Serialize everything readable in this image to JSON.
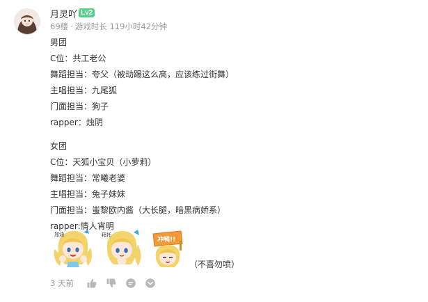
{
  "user": {
    "name": "月灵吖",
    "level": "Lv2"
  },
  "meta": {
    "floor": "69楼",
    "separator": "·",
    "play_time": "游戏时长 119小时42分钟"
  },
  "male_group": {
    "title": "男团",
    "lines": [
      "C位：共工老公",
      "舞蹈担当：夸父（被动踢这么高，应该练过街舞）",
      "主唱担当：九尾狐",
      "门面担当：狗子",
      "rapper：烛阴"
    ]
  },
  "female_group": {
    "title": "女团",
    "lines": [
      "C位：天狐小宝贝（小萝莉）",
      "舞蹈担当：常曦老婆",
      "主唱担当：兔子妹妹",
      "门面担当：蚩黎欧内酱（大长腿，暗黑病娇系）",
      "rapper:情人宵明"
    ]
  },
  "stickers": {
    "s1_text": "加油",
    "s2_text": "拜托",
    "s3_text": "冲鸭!!",
    "note": "（不喜勿喷）"
  },
  "footer": {
    "time": "3 天前"
  },
  "colors": {
    "text": "#333333",
    "meta": "#999999",
    "level_badge": "#56d08a",
    "icon": "#b8b8b8"
  },
  "icons": [
    "avatar",
    "thumb-up-icon",
    "thumb-down-icon",
    "comment-icon",
    "more-icon"
  ]
}
